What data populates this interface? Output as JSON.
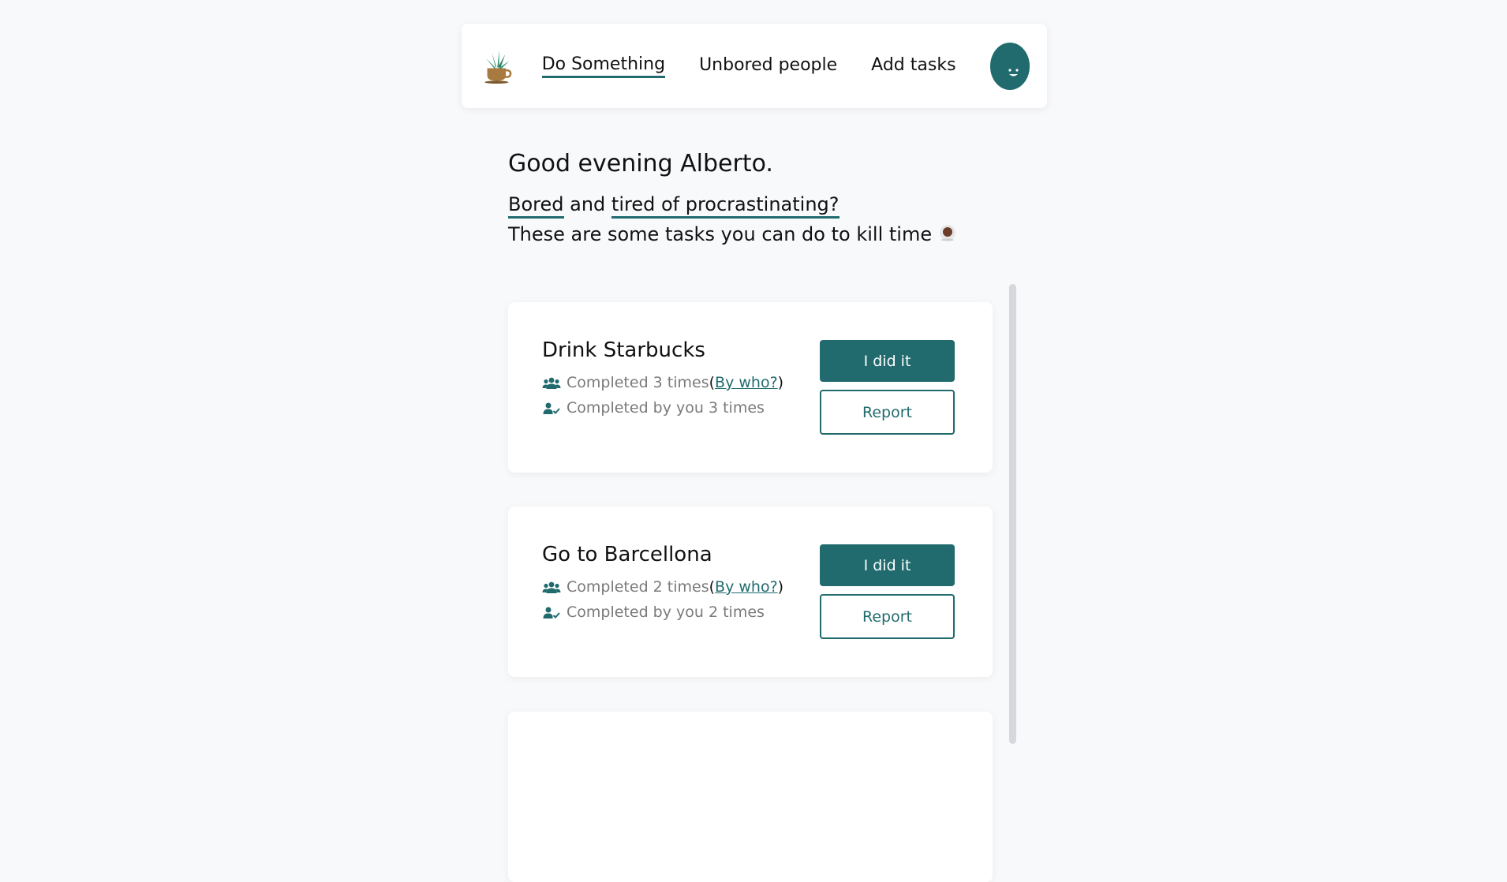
{
  "nav": {
    "links": [
      {
        "label": "Do Something"
      },
      {
        "label": "Unbored people"
      },
      {
        "label": "Add tasks"
      }
    ],
    "avatar_face": ". ."
  },
  "intro": {
    "greeting": "Good evening Alberto.",
    "bored": "Bored",
    "and": " and ",
    "tired": "tired of procrastinating?",
    "kill_time": "These are some tasks you can do to kill time "
  },
  "tasks": [
    {
      "title": "Drink Starbucks",
      "completed_text": "Completed 3 times",
      "by_who": "By who?",
      "completed_by_you": "Completed by you 3 times",
      "done_label": "I did it",
      "report_label": "Report"
    },
    {
      "title": "Go to Barcellona",
      "completed_text": "Completed 2 times",
      "by_who": "By who?",
      "completed_by_you": "Completed by you 2 times",
      "done_label": "I did it",
      "report_label": "Report"
    }
  ],
  "colors": {
    "accent": "#216b6e",
    "background": "#f8f9fb",
    "muted_text": "#7a7a7a"
  },
  "icons": {
    "logo": "plant-coffee-cup-logo",
    "group": "users-group-icon",
    "user_check": "user-check-icon",
    "coffee": "coffee-cup-icon"
  }
}
